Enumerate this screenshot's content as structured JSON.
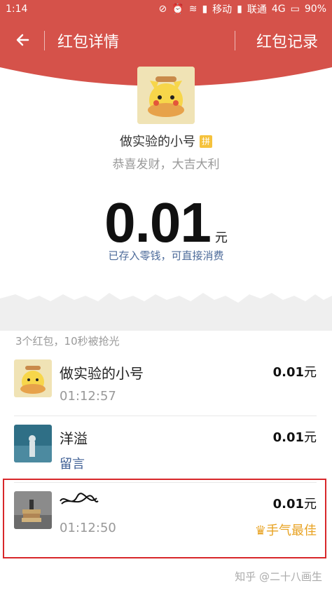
{
  "status": {
    "time": "1:14",
    "carrier1": "移动",
    "carrier2": "联通",
    "network": "4G",
    "battery": "90%"
  },
  "header": {
    "title": "红包详情",
    "records": "红包记录",
    "color": "#d5524a"
  },
  "hero": {
    "sender": "做实验的小号",
    "pin_badge": "拼",
    "greeting": "恭喜发财，大吉大利",
    "amount": "0.01",
    "unit": "元",
    "stored": "已存入零钱，可直接消费"
  },
  "summary": "3个红包，10秒被抢光",
  "list": [
    {
      "name": "做实验的小号",
      "time": "01:12:57",
      "amount": "0.01",
      "unit": "元"
    },
    {
      "name": "洋溢",
      "message": "留言",
      "amount": "0.01",
      "unit": "元"
    },
    {
      "name": "",
      "time": "01:12:50",
      "amount": "0.01",
      "unit": "元",
      "best": "手气最佳"
    }
  ],
  "watermark": "知乎 @二十八画生"
}
